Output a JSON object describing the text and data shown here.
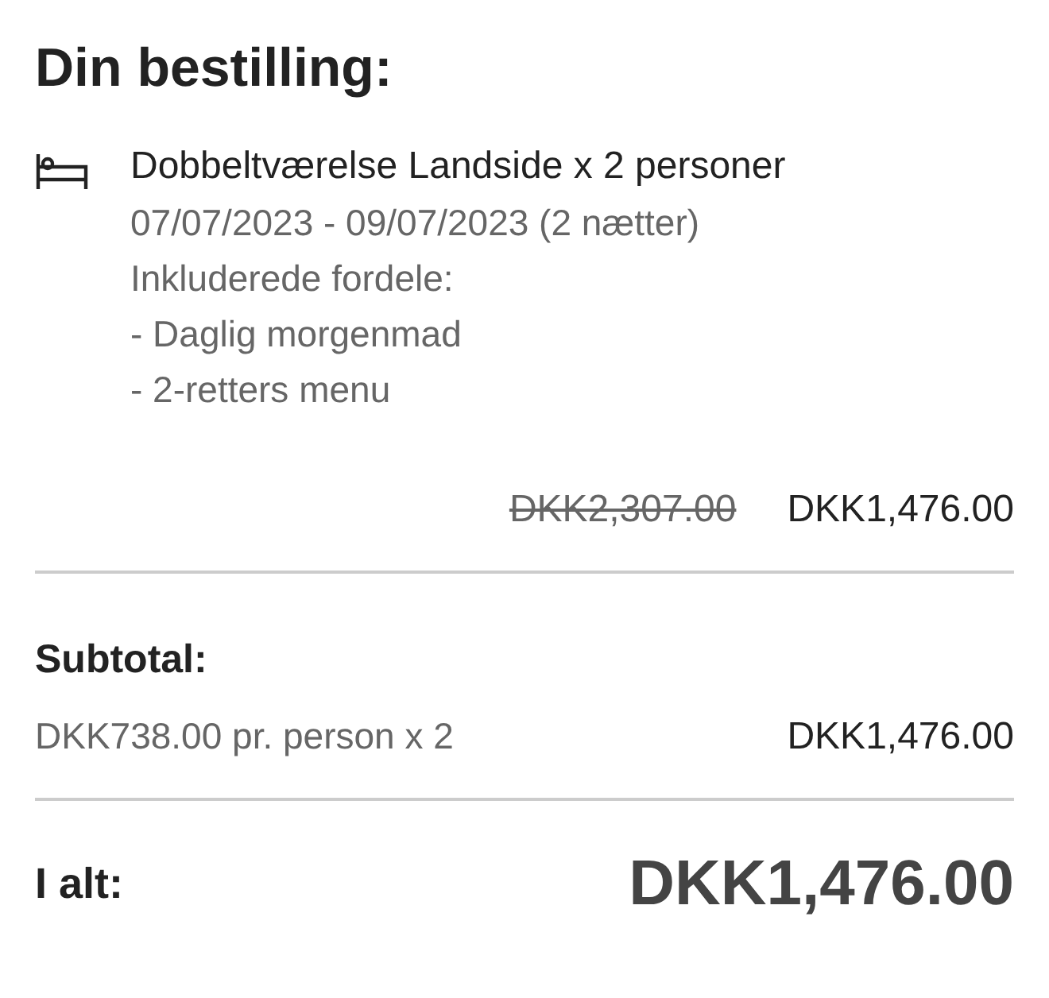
{
  "title": "Din bestilling:",
  "item": {
    "name": "Dobbeltværelse Landside x 2 personer",
    "dates": "07/07/2023 - 09/07/2023 (2 nætter)",
    "benefits_label": "Inkluderede fordele:",
    "benefits": [
      "- Daglig morgenmad",
      "- 2-retters menu"
    ],
    "original_price": "DKK2,307.00",
    "price": "DKK1,476.00"
  },
  "subtotal": {
    "label": "Subtotal:",
    "detail": "DKK738.00 pr. person x 2",
    "amount": "DKK1,476.00"
  },
  "total": {
    "label": "I alt:",
    "amount": "DKK1,476.00"
  }
}
